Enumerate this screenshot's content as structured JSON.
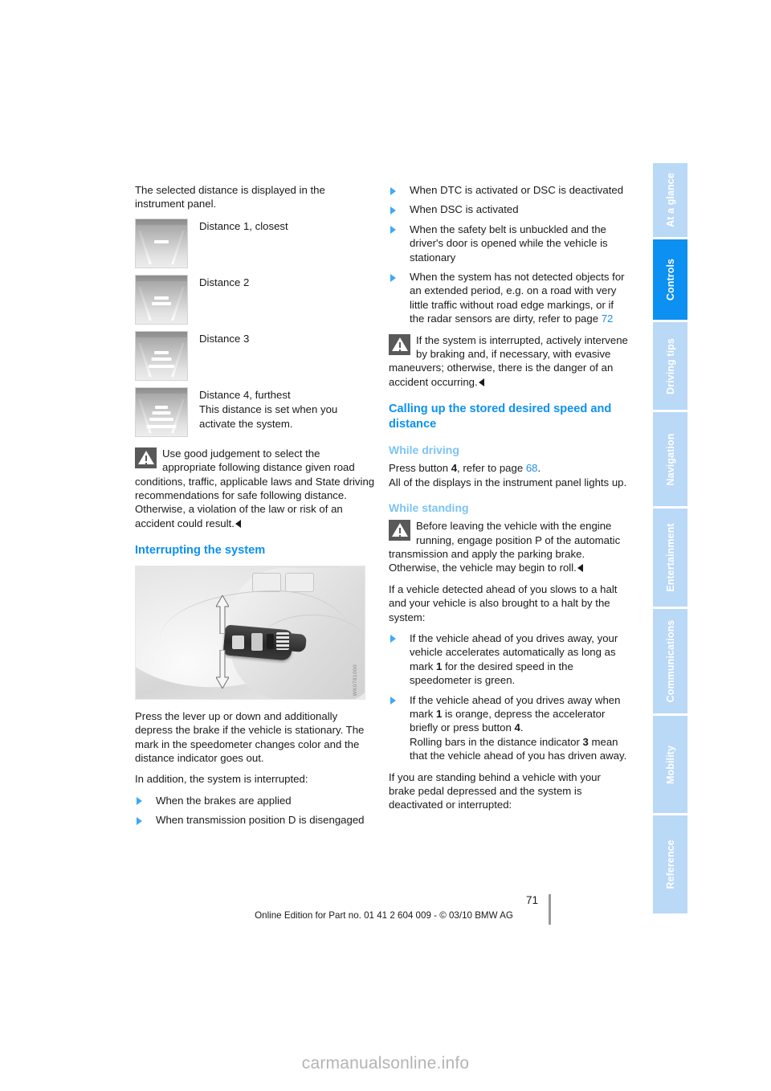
{
  "page": {
    "number": "71",
    "footer_note": "Online Edition for Part no. 01 41 2 604 009 - © 03/10 BMW AG",
    "watermark": "carmanualsonline.info"
  },
  "tabs": {
    "active": "Controls",
    "items": [
      {
        "label": "At a glance",
        "active": false
      },
      {
        "label": "Controls",
        "active": true
      },
      {
        "label": "Driving tips",
        "active": false
      },
      {
        "label": "Navigation",
        "active": false
      },
      {
        "label": "Entertainment",
        "active": false
      },
      {
        "label": "Communications",
        "active": false
      },
      {
        "label": "Mobility",
        "active": false
      },
      {
        "label": "Reference",
        "active": false
      }
    ]
  },
  "colors": {
    "heading_blue": "#0c90f2",
    "subheading_blue": "#7cc4f5",
    "tab_active": "#0c90f2",
    "tab_inactive": "#b9d9f7",
    "bullet_marker": "#3fa9f5",
    "page_reference": "#1f8fe0"
  },
  "left_column": {
    "intro": "The selected distance is displayed in the instrument panel.",
    "distances": [
      {
        "bars": 1,
        "label": "Distance 1, closest",
        "note": ""
      },
      {
        "bars": 2,
        "label": "Distance 2",
        "note": ""
      },
      {
        "bars": 3,
        "label": "Distance 3",
        "note": ""
      },
      {
        "bars": 4,
        "label": "Distance 4, furthest",
        "note": "This distance is set when you activate the system."
      }
    ],
    "warning": "Use good judgement to select the appropriate following distance given road conditions, traffic, applicable laws and State driving recommendations for safe following distance. Otherwise, a violation of the law or risk of an accident could result.",
    "heading_interrupting": "Interrupting the system",
    "photo_caption_code": "WK0781000",
    "after_photo_1": "Press the lever up or down and additionally depress the brake if the vehicle is stationary. The mark in the speedometer changes color and the distance indicator goes out.",
    "after_photo_2": "In addition, the system is interrupted:",
    "interrupt_bullets": [
      "When the brakes are applied",
      "When transmission position D is disengaged"
    ]
  },
  "right_column": {
    "bullets_top": [
      "When DTC is activated or DSC is deactivated",
      "When DSC is activated",
      "When the safety belt is unbuckled and the driver's door is opened while the vehicle is stationary"
    ],
    "bullet_with_ref": {
      "text_before": "When the system has not detected objects for an extended period, e.g. on a road with very little traffic without road edge markings, or if the radar sensors are dirty, refer to page ",
      "page_ref": "72"
    },
    "warning": "If the system is interrupted, actively intervene by braking and, if necessary, with evasive maneuvers; otherwise, there is the danger of an accident occurring.",
    "heading_calling_up": "Calling up the stored desired speed and distance",
    "subheading_while_driving": "While driving",
    "while_driving_line1_a": "Press button ",
    "while_driving_line1_b": "4",
    "while_driving_line1_c": ", refer to page ",
    "while_driving_page_ref": "68",
    "while_driving_line1_d": ".",
    "while_driving_line2": "All of the displays in the instrument panel lights up.",
    "subheading_while_standing": "While standing",
    "standing_warning": "Before leaving the vehicle with the engine running, engage position P of the automatic transmission and apply the parking brake. Otherwise, the vehicle may begin to roll.",
    "standing_intro": "If a vehicle detected ahead of you slows to a halt and your vehicle is also brought to a halt by the system:",
    "standing_bullet_1": {
      "a": "If the vehicle ahead of you drives away, your vehicle accelerates automatically as long as mark ",
      "b": "1",
      "c": " for the desired speed in the speedometer is green."
    },
    "standing_bullet_2": {
      "a": "If the vehicle ahead of you drives away when mark ",
      "b": "1",
      "c": " is orange, depress the accelerator briefly or press button ",
      "d": "4",
      "e": ".",
      "f": "Rolling bars in the distance indicator ",
      "g": "3",
      "h": " mean that the vehicle ahead of you has driven away."
    },
    "standing_closing": "If you are standing behind a vehicle with your brake pedal depressed and the system is deactivated or interrupted:"
  }
}
